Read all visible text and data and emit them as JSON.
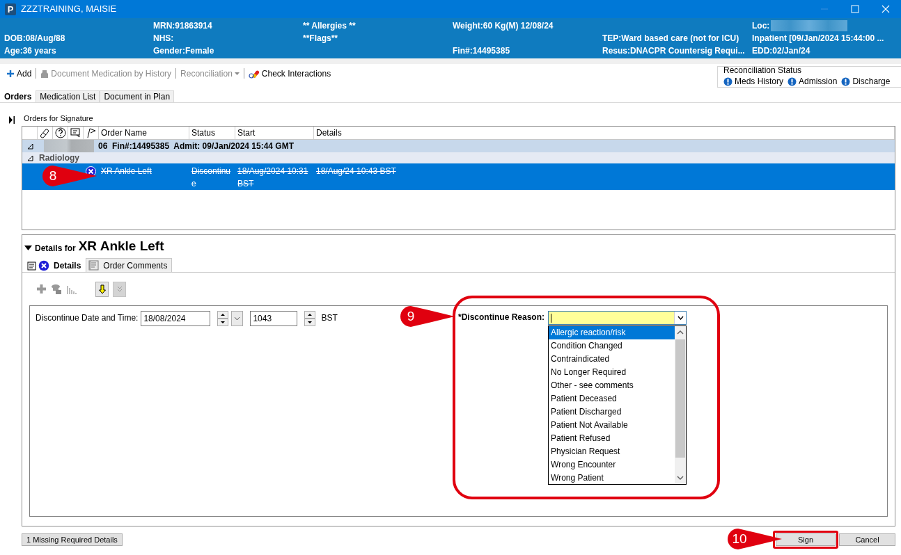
{
  "window": {
    "icon_letter": "P",
    "title": "ZZZTRAINING, MAISIE"
  },
  "banner": {
    "columns": [
      {
        "middle": {
          "text": "DOB:08/Aug/88"
        },
        "bottom": {
          "text": "Age:36 years"
        }
      },
      {
        "top": {
          "text": "MRN:91863914"
        },
        "middle": {
          "text": "NHS:"
        },
        "bottom": {
          "text": "Gender:Female"
        }
      },
      {
        "top": {
          "text": "** Allergies **"
        },
        "middle": {
          "text": "**Flags**"
        }
      },
      {
        "top": {
          "text": "Weight:60 Kg(M) 12/08/24"
        },
        "bottom": {
          "text": "Fin#:14495385"
        }
      },
      {
        "middle": {
          "text": "TEP:Ward based care (not for ICU)"
        },
        "bottom": {
          "text": "Resus:DNACPR Countersig Requi..."
        }
      },
      {
        "top": {
          "text": "Loc:",
          "redacted": true
        },
        "middle": {
          "text": "Inpatient [09/Jan/2024 15:44:00 ..."
        },
        "bottom": {
          "text": "EDD:02/Jan/24"
        }
      }
    ]
  },
  "toolbar": {
    "items": [
      {
        "kind": "add",
        "label": "Add",
        "disabled": false
      },
      {
        "kind": "history",
        "label": "Document Medication by History",
        "disabled": true
      },
      {
        "kind": "menu",
        "label": "Reconciliation",
        "disabled": true
      },
      {
        "kind": "interactions",
        "label": "Check Interactions",
        "disabled": false
      }
    ]
  },
  "reconciliation_status": {
    "title": "Reconciliation Status",
    "items": [
      "Meds History",
      "Admission",
      "Discharge"
    ]
  },
  "tabs": [
    {
      "label": "Orders",
      "selected": true
    },
    {
      "label": "Medication List",
      "selected": false
    },
    {
      "label": "Document in Plan",
      "selected": false
    }
  ],
  "orders": {
    "title": "Orders for Signature",
    "columns": [
      "Order Name",
      "Status",
      "Start",
      "Details"
    ],
    "encounter": {
      "text": "06  Fin#:14495385  Admit: 09/Jan/2024 15:44 GMT",
      "expanded": true,
      "redacted": true
    },
    "groups": [
      {
        "name": "Radiology",
        "expanded": true,
        "rows": [
          {
            "name": "XR Ankle Left",
            "status": "Discontinue",
            "start": "18/Aug/2024 10:31 BST",
            "details": "18/Aug/24 10:43 BST",
            "selected": true,
            "discontinued": true,
            "callout": "8"
          }
        ]
      }
    ]
  },
  "details": {
    "title_prefix": "Details for",
    "title": "XR Ankle Left",
    "tabs": [
      {
        "label": "Details",
        "selected": true
      },
      {
        "label": "Order Comments",
        "selected": false
      }
    ],
    "form": {
      "date_label": "Discontinue Date and Time:",
      "date": "18/08/2024",
      "time": "1043",
      "zone": "BST",
      "reason": {
        "label": "*Discontinue Reason:",
        "required": true,
        "expanded": true,
        "highlighted": true,
        "callout": "9",
        "options": [
          {
            "label": "Allergic reaction/risk",
            "selected": true
          },
          {
            "label": "Condition Changed",
            "selected": false
          },
          {
            "label": "Contraindicated",
            "selected": false
          },
          {
            "label": "No Longer Required",
            "selected": false
          },
          {
            "label": "Other - see comments",
            "selected": false
          },
          {
            "label": "Patient Deceased",
            "selected": false
          },
          {
            "label": "Patient Discharged",
            "selected": false
          },
          {
            "label": "Patient Not Available",
            "selected": false
          },
          {
            "label": "Patient Refused",
            "selected": false
          },
          {
            "label": "Physician Request",
            "selected": false
          },
          {
            "label": "Wrong Encounter",
            "selected": false
          },
          {
            "label": "Wrong Patient",
            "selected": false
          }
        ]
      }
    }
  },
  "footer": {
    "missing": "1 Missing Required Details",
    "buttons": [
      {
        "label": "Sign",
        "highlighted": true,
        "callout": "10"
      },
      {
        "label": "Cancel",
        "highlighted": false
      }
    ]
  }
}
